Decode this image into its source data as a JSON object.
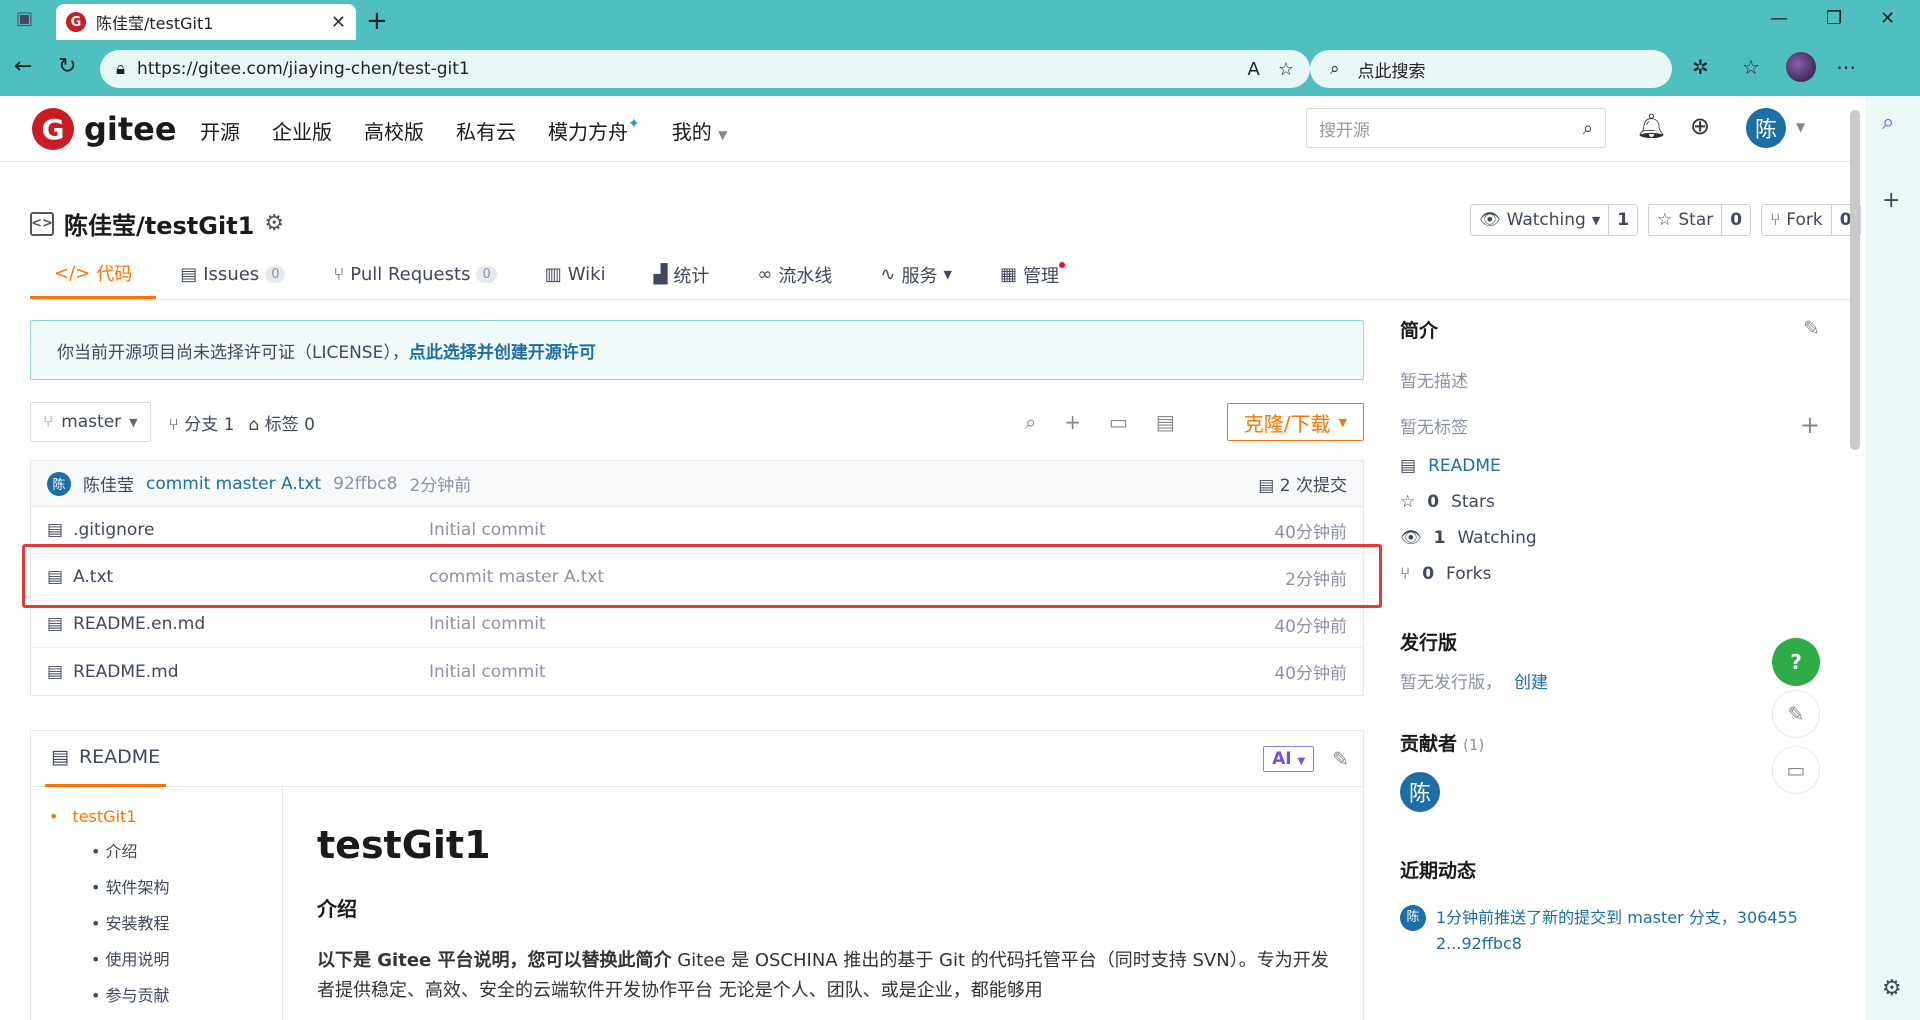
{
  "browser": {
    "tab_title": "陈佳莹/testGit1",
    "url": "https://gitee.com/jiaying-chen/test-git1",
    "search_placeholder": "点此搜索"
  },
  "header": {
    "logo": "gitee",
    "nav": [
      "开源",
      "企业版",
      "高校版",
      "私有云",
      "模力方舟",
      "我的"
    ],
    "search_placeholder": "搜开源",
    "avatar_char": "陈"
  },
  "repo": {
    "title": "陈佳莹/testGit1",
    "watching_label": "Watching",
    "watching_count": "1",
    "star_label": "Star",
    "star_count": "0",
    "fork_label": "Fork",
    "fork_count": "0"
  },
  "tabs": [
    {
      "label": "代码"
    },
    {
      "label": "Issues",
      "count": "0"
    },
    {
      "label": "Pull Requests",
      "count": "0"
    },
    {
      "label": "Wiki"
    },
    {
      "label": "统计"
    },
    {
      "label": "流水线"
    },
    {
      "label": "服务"
    },
    {
      "label": "管理"
    }
  ],
  "notice": {
    "text": "你当前开源项目尚未选择许可证（LICENSE），",
    "link": "点此选择并创建开源许可"
  },
  "branchbar": {
    "branch": "master",
    "branches": "分支 1",
    "tags": "标签 0",
    "clone_label": "克隆/下载"
  },
  "last_commit": {
    "author": "陈佳莹",
    "avatar_char": "陈",
    "message": "commit master A.txt",
    "hash": "92ffbc8",
    "time": "2分钟前",
    "commits": "2 次提交"
  },
  "files": [
    {
      "name": ".gitignore",
      "message": "Initial commit",
      "time": "40分钟前"
    },
    {
      "name": "A.txt",
      "message": "commit master A.txt",
      "time": "2分钟前"
    },
    {
      "name": "README.en.md",
      "message": "Initial commit",
      "time": "40分钟前"
    },
    {
      "name": "README.md",
      "message": "Initial commit",
      "time": "40分钟前"
    }
  ],
  "readme": {
    "tab_label": "README",
    "ai_label": "AI",
    "toc_top": "testGit1",
    "toc": [
      "介绍",
      "软件架构",
      "安装教程",
      "使用说明",
      "参与贡献"
    ],
    "h1": "testGit1",
    "h3": "介绍",
    "para_bold": "以下是 Gitee 平台说明，您可以替换此简介",
    "para": " Gitee 是 OSCHINA 推出的基于 Git 的代码托管平台（同时支持 SVN）。专为开发者提供稳定、高效、安全的云端软件开发协作平台 无论是个人、团队、或是企业，都能够用"
  },
  "sidebar": {
    "intro_title": "简介",
    "no_desc": "暂无描述",
    "no_tags": "暂无标签",
    "readme": "README",
    "stars_n": "0",
    "stars": "Stars",
    "watching_n": "1",
    "watching": "Watching",
    "forks_n": "0",
    "forks": "Forks",
    "release_title": "发行版",
    "no_release": "暂无发行版，",
    "create": "创建",
    "contrib_title": "贡献者",
    "contrib_count": "(1)",
    "contrib_avatar": "陈",
    "recent_title": "近期动态",
    "activity": "1分钟前推送了新的提交到 master 分支，306455 2...92ffbc8"
  }
}
